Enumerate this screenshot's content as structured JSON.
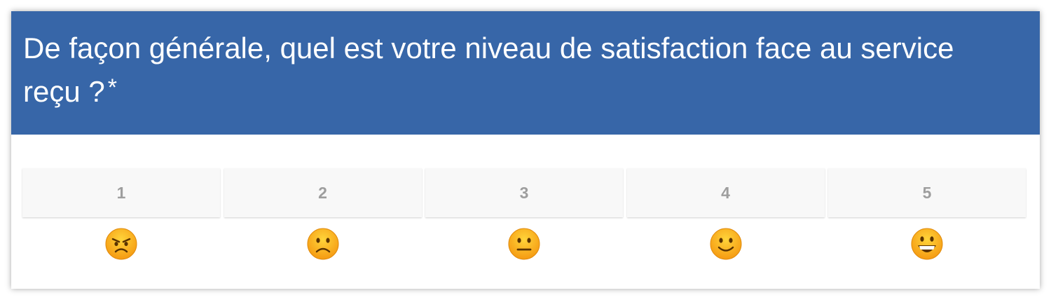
{
  "question": {
    "text": "De façon générale, quel est votre niveau de satisfaction face au service reçu ?",
    "required_marker": "*"
  },
  "colors": {
    "header_bg": "#3766a8",
    "option_bg": "#f8f8f8",
    "option_text": "#9e9e9e"
  },
  "scale": {
    "options": [
      {
        "label": "1",
        "icon": "angry-face-icon"
      },
      {
        "label": "2",
        "icon": "slightly-frowning-face-icon"
      },
      {
        "label": "3",
        "icon": "neutral-face-icon"
      },
      {
        "label": "4",
        "icon": "slightly-smiling-face-icon"
      },
      {
        "label": "5",
        "icon": "grinning-face-icon"
      }
    ]
  }
}
